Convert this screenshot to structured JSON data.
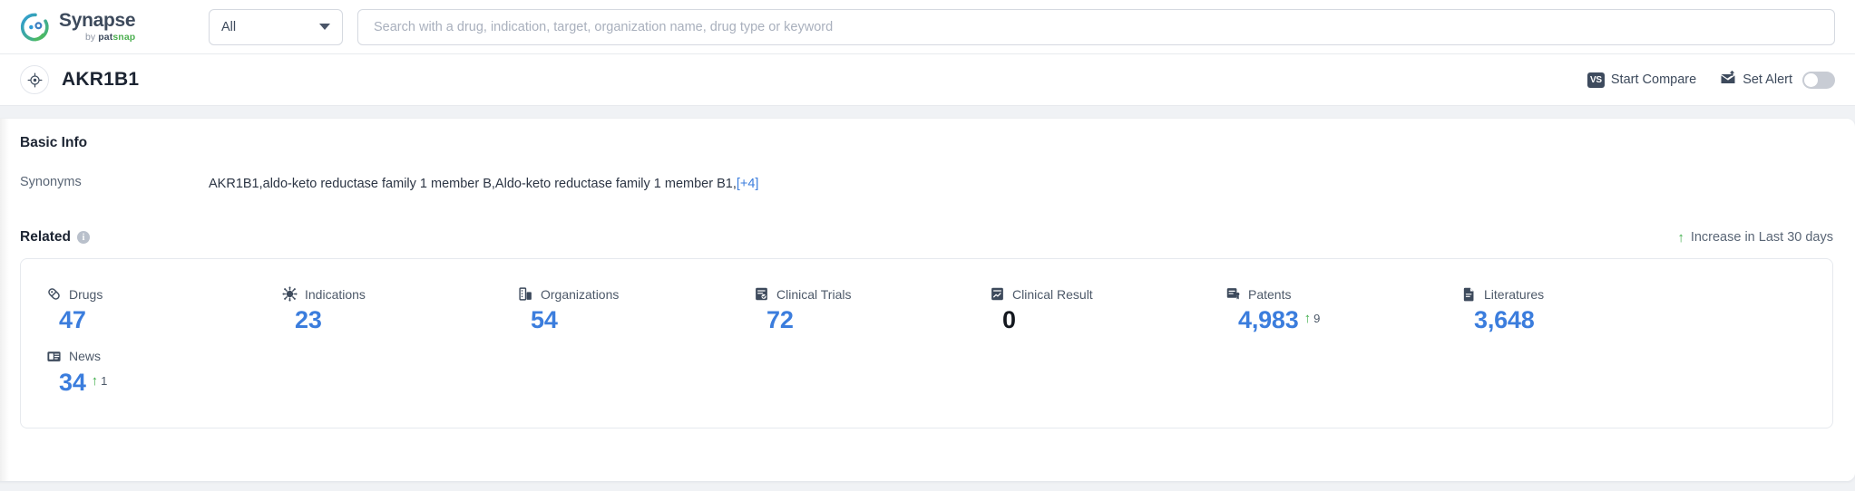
{
  "topbar": {
    "logo": {
      "title": "Synapse",
      "by": "by ",
      "brand_pat": "pat",
      "brand_snap": "snap"
    },
    "scope_select": {
      "value": "All",
      "icon": "chevron-down-icon"
    },
    "search": {
      "value": "",
      "placeholder": "Search with a drug, indication, target, organization name, drug type or keyword"
    }
  },
  "entity_header": {
    "icon": "target-icon",
    "title": "AKR1B1",
    "actions": {
      "start_compare": {
        "label": "Start Compare",
        "badge": "VS",
        "icon": "vs-icon"
      },
      "set_alert": {
        "label": "Set Alert",
        "icon": "alert-mail-icon",
        "toggle_on": false
      }
    }
  },
  "basic_info": {
    "section_title": "Basic Info",
    "info_icon": "i",
    "synonyms": {
      "label": "Synonyms",
      "value": "AKR1B1,aldo-keto reductase family 1 member B,Aldo-keto reductase family 1 member B1,",
      "more_link": "[+4]"
    }
  },
  "related": {
    "section_title": "Related",
    "info_icon": "i",
    "increase_note": "Increase in Last 30 days",
    "increase_arrow": "↑",
    "colors": {
      "value_blue": "#3b7ddd",
      "increase_green": "#3fae4b",
      "zero_black": "#14181f"
    },
    "stats": [
      {
        "label": "Drugs",
        "icon": "pill-icon",
        "value": "47",
        "delta": null,
        "is_zero": false
      },
      {
        "label": "Indications",
        "icon": "virus-icon",
        "value": "23",
        "delta": null,
        "is_zero": false
      },
      {
        "label": "Organizations",
        "icon": "building-icon",
        "value": "54",
        "delta": null,
        "is_zero": false
      },
      {
        "label": "Clinical Trials",
        "icon": "clinical-trial-icon",
        "value": "72",
        "delta": null,
        "is_zero": false
      },
      {
        "label": "Clinical Result",
        "icon": "clinical-result-icon",
        "value": "0",
        "delta": null,
        "is_zero": true
      },
      {
        "label": "Patents",
        "icon": "patent-icon",
        "value": "4,983",
        "delta": "9",
        "is_zero": false
      },
      {
        "label": "Literatures",
        "icon": "literature-icon",
        "value": "3,648",
        "delta": null,
        "is_zero": false
      },
      {
        "label": "News",
        "icon": "news-icon",
        "value": "34",
        "delta": "1",
        "is_zero": false
      }
    ]
  }
}
